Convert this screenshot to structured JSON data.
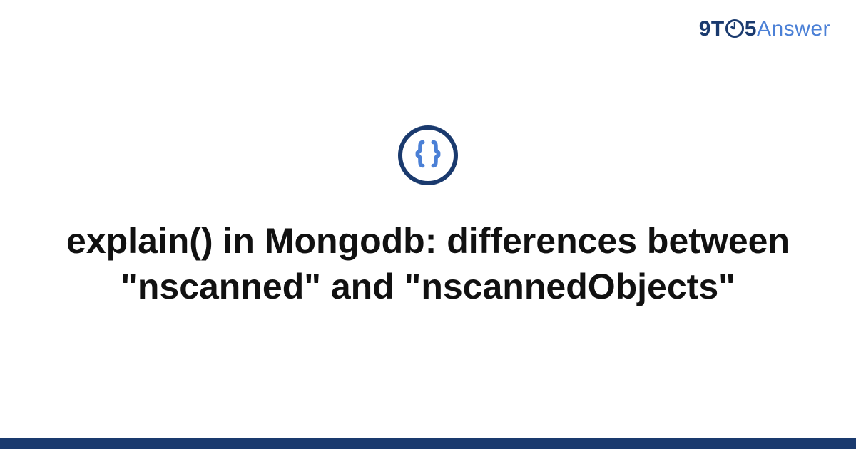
{
  "brand": {
    "part1": "9T",
    "part2": "5",
    "part3": "Answer"
  },
  "icon": {
    "name": "code-braces-icon",
    "ring_color": "#1a3a6e",
    "glyph_color": "#4b80d6"
  },
  "title": "explain() in Mongodb: differences between \"nscanned\" and \"nscannedObjects\"",
  "footer_color": "#1a3a6e"
}
